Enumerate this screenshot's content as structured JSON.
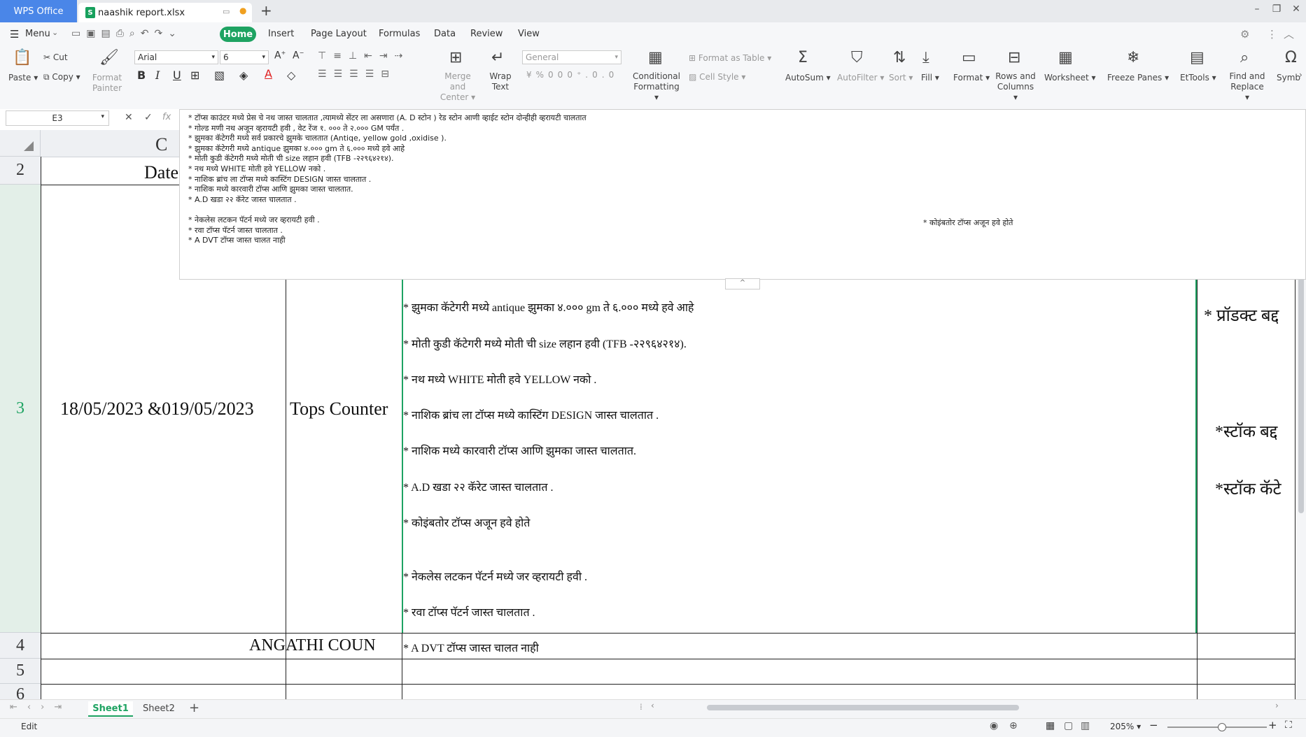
{
  "titlebar": {
    "app_tab": "WPS Office",
    "file_tab": "naashik report.xlsx",
    "new_tab": "+"
  },
  "menu": {
    "menu_label": "Menu",
    "tabs": [
      "Home",
      "Insert",
      "Page Layout",
      "Formulas",
      "Data",
      "Review",
      "View"
    ]
  },
  "ribbon": {
    "paste": "Paste",
    "cut": "Cut",
    "copy": "Copy",
    "format_painter_1": "Format",
    "format_painter_2": "Painter",
    "font_name": "Arial",
    "font_size": "6",
    "merge_1": "Merge and",
    "merge_2": "Center",
    "wrap_1": "Wrap",
    "wrap_2": "Text",
    "number_format": "General",
    "cond_1": "Conditional",
    "cond_2": "Formatting",
    "format_as_table": "Format as Table",
    "cell_style": "Cell Style",
    "autosum": "AutoSum",
    "autofilter": "AutoFilter",
    "sort": "Sort",
    "fill": "Fill",
    "format": "Format",
    "rows_cols_1": "Rows and",
    "rows_cols_2": "Columns",
    "worksheet": "Worksheet",
    "freeze_panes": "Freeze Panes",
    "etools": "EtTools",
    "find_1": "Find and",
    "find_2": "Replace",
    "symbol": "Symb"
  },
  "formula_bar": {
    "name_box": "E3",
    "fx": "fx",
    "lines": [
      "* टॉप्स काउंटर मध्ये प्रेस चे नथ जास्त चालतात ,त्यामध्ये सेंटर ला असणारा (A. D स्टोन ) रेड स्टोन आणी व्हाईट स्टोन दोन्हीही व्हरायटी चालतात",
      "* गोल्ड मणी नथ अजून व्हरायटी हवी , वेट रेंज १. ००० ते २.००० GM पर्यंत .",
      "* झुमका कॅटेगरी मध्ये सर्व प्रकारचे झुमके चालतात (Antiqe, yellow gold ,oxidise ).",
      "* झुमका कॅटेगरी मध्ये antique झुमका ४.००० gm ते ६.००० मध्ये हवे आहे",
      "* मोती कुडी कॅटेगरी मध्ये मोती ची size लहान हवी (TFB -२२९६४२१४).",
      "* नथ मध्ये WHITE मोती हवे YELLOW नको .",
      "* नाशिक ब्रांच ला टॉप्स मध्ये कास्टिंग DESIGN जास्त चालतात .",
      "* नाशिक मध्ये कारवारी टॉप्स आणि झुमका जास्त चालतात.",
      "* A.D खडा २२ कॅरेट जास्त चालतात .",
      "",
      "* नेकलेस लटकन पॅटर्न मध्ये जर व्हरायटी हवी .",
      "* रवा टॉप्स पॅटर्न जास्त चालतात .",
      "* A DVT टॉप्स जास्त चालत नाही"
    ],
    "right_note": "* कोइंबतोर टॉप्स अजून हवे होते"
  },
  "grid": {
    "col_c_header": "C",
    "rows": [
      "2",
      "3",
      "4",
      "5",
      "6"
    ],
    "row2_date": "Date",
    "row3_date": "18/05/2023 &019/05/2023",
    "row3_counter": "Tops Counter",
    "row4_text": "ANGATHI COUN",
    "details": [
      "* झुमका कॅटेगरी मध्ये antique झुमका ४.००० gm ते ६.००० मध्ये हवे आहे",
      "* मोती कुडी कॅटेगरी मध्ये मोती ची size लहान हवी (TFB -२२९६४२१४).",
      "* नथ मध्ये WHITE मोती हवे YELLOW नको .",
      "* नाशिक ब्रांच ला टॉप्स मध्ये कास्टिंग DESIGN जास्त चालतात .",
      "* नाशिक मध्ये कारवारी टॉप्स आणि झुमका जास्त चालतात.",
      "* A.D खडा २२ कॅरेट जास्त चालतात .",
      "* कोइंबतोर टॉप्स अजून हवे होते",
      "* नेकलेस लटकन पॅटर्न मध्ये जर व्हरायटी हवी .",
      "* रवा टॉप्स पॅटर्न जास्त चालतात .",
      "* A DVT टॉप्स जास्त चालत नाही"
    ],
    "right_col": [
      "* प्रॉडक्ट बद्द",
      "*स्टॉक बद्द",
      "*स्टॉक कॅटे"
    ]
  },
  "sheets": {
    "tabs": [
      "Sheet1",
      "Sheet2"
    ],
    "add": "+"
  },
  "status": {
    "mode": "Edit",
    "zoom": "205%",
    "zoom_level": 0.55
  },
  "colors": {
    "accent": "#1ea362",
    "brand": "#4a86e8"
  }
}
